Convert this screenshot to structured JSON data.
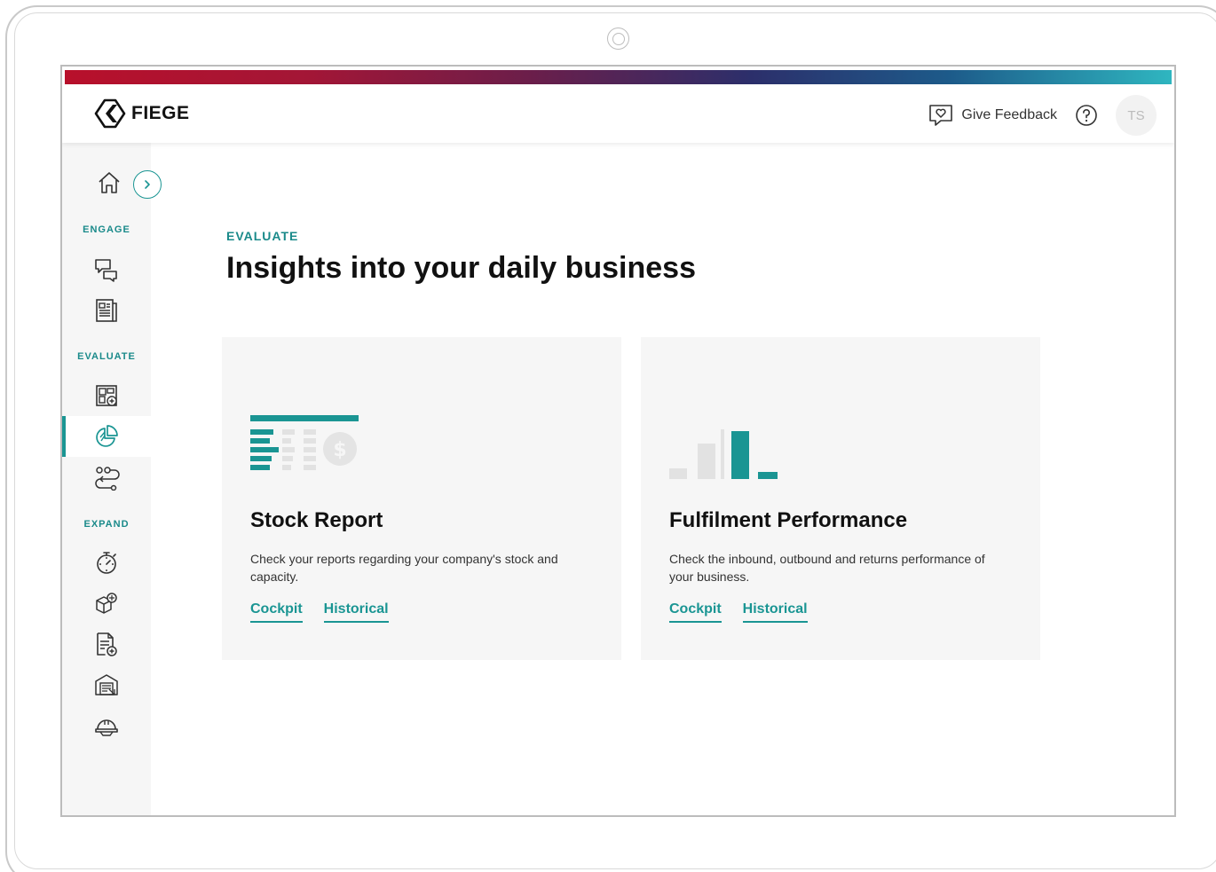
{
  "header": {
    "logo_text": "FIEGE",
    "feedback_label": "Give Feedback",
    "avatar_initials": "TS"
  },
  "sidebar": {
    "sections": [
      {
        "label": "ENGAGE",
        "items": [
          "chat-icon",
          "news-icon"
        ]
      },
      {
        "label": "EVALUATE",
        "items": [
          "dashboard-add-icon",
          "pie-chart-icon",
          "flow-icon"
        ]
      },
      {
        "label": "EXPAND",
        "items": [
          "stopwatch-icon",
          "boxes-icon",
          "document-add-icon",
          "building-icon",
          "helmet-icon"
        ]
      }
    ],
    "active_item": "pie-chart-icon"
  },
  "main": {
    "eyebrow": "EVALUATE",
    "title": "Insights into your daily business",
    "cards": [
      {
        "title": "Stock Report",
        "description": "Check your reports regarding your company's stock and capacity.",
        "links": [
          "Cockpit",
          "Historical"
        ],
        "icon": "stock-report-icon"
      },
      {
        "title": "Fulfilment Performance",
        "description": "Check the inbound, outbound and returns performance of your business.",
        "links": [
          "Cockpit",
          "Historical"
        ],
        "icon": "bar-chart-icon"
      }
    ]
  },
  "colors": {
    "accent": "#1a9593",
    "accent_text": "#1a8a8a",
    "sidebar_bg": "#f6f6f6",
    "card_bg": "#f6f6f6"
  }
}
